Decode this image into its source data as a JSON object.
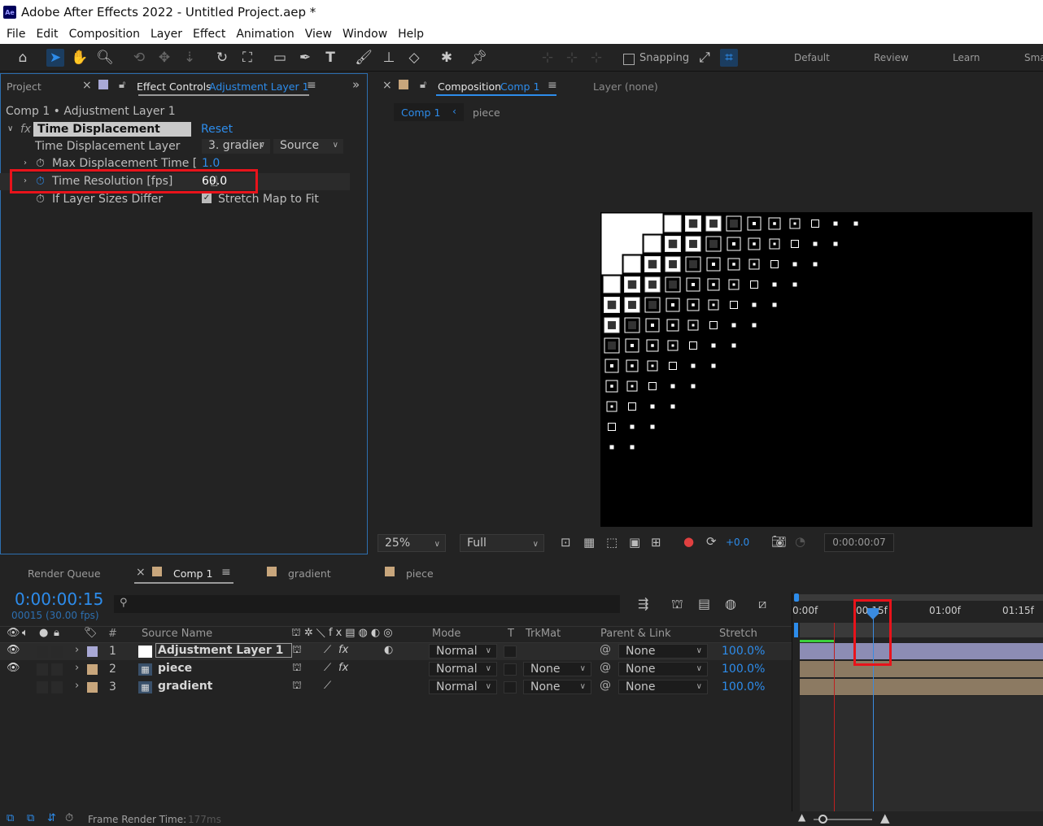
{
  "window": {
    "title": "Adobe After Effects 2022 - Untitled Project.aep *",
    "app_icon": "Ae"
  },
  "menu": [
    "File",
    "Edit",
    "Composition",
    "Layer",
    "Effect",
    "Animation",
    "View",
    "Window",
    "Help"
  ],
  "toolbar": {
    "snapping_label": "Snapping",
    "workspaces": [
      "Default",
      "Review",
      "Learn",
      "Sma"
    ]
  },
  "left_panel": {
    "project_tab": "Project",
    "effect_controls_tab": "Effect Controls",
    "effect_controls_target": "Adjustment Layer 1",
    "breadcrumb": "Comp 1 • Adjustment Layer 1",
    "effect": {
      "fx_label": "fx",
      "name": "Time Displacement",
      "reset": "Reset",
      "displacement_layer_label": "Time Displacement Layer",
      "displacement_layer_value": "3. gradier",
      "source_value": "Source",
      "max_displacement_label": "Max Displacement Time [",
      "max_displacement_value": "1.0",
      "time_resolution_label": "Time Resolution [fps]",
      "time_resolution_value": "60.0",
      "layer_sizes_label": "If Layer Sizes Differ",
      "stretch_label": "Stretch Map to Fit"
    }
  },
  "comp_panel": {
    "tab_prefix": "Composition",
    "tab_name": "Comp 1",
    "layer_tab": "Layer (none)",
    "nav_comp": "Comp 1",
    "nav_piece": "piece",
    "zoom": "25%",
    "resolution": "Full",
    "exposure": "+0.0",
    "timecode": "0:00:00:07"
  },
  "timeline": {
    "tabs": {
      "render_queue": "Render Queue",
      "comp1": "Comp 1",
      "gradient": "gradient",
      "piece": "piece"
    },
    "current_time": "0:00:00:15",
    "current_frame": "00015 (30.00 fps)",
    "search_placeholder": "",
    "columns": {
      "num": "#",
      "source_name": "Source Name",
      "mode": "Mode",
      "t": "T",
      "trkmat": "TrkMat",
      "parent": "Parent & Link",
      "stretch": "Stretch"
    },
    "ruler": [
      "0:00f",
      "00:15f",
      "01:00f",
      "01:15f"
    ],
    "layers": [
      {
        "num": "1",
        "name": "Adjustment Layer 1",
        "mode": "Normal",
        "trkmat": "",
        "parent": "None",
        "stretch": "100.0%",
        "label_color": "#a9a9d6"
      },
      {
        "num": "2",
        "name": "piece",
        "mode": "Normal",
        "trkmat": "None",
        "parent": "None",
        "stretch": "100.0%",
        "label_color": "#c8a67c"
      },
      {
        "num": "3",
        "name": "gradient",
        "mode": "Normal",
        "trkmat": "None",
        "parent": "None",
        "stretch": "100.0%",
        "label_color": "#c8a67c"
      }
    ]
  },
  "status": {
    "label": "Frame Render Time:",
    "value": "177ms"
  },
  "colors": {
    "accent": "#2d8ceb",
    "highlight_box": "#e8131b",
    "panel_bg": "#232323"
  }
}
